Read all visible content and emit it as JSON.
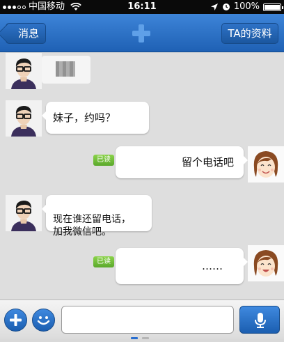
{
  "status_bar": {
    "carrier": "中国移动",
    "time": "16:11",
    "battery": "100%"
  },
  "nav": {
    "back_label": "消息",
    "profile_label": "TA的资料"
  },
  "messages": [
    {
      "side": "left",
      "kind": "image"
    },
    {
      "side": "left",
      "kind": "text",
      "text": "妹子，约吗？"
    },
    {
      "side": "right",
      "kind": "text",
      "text": "留个电话吧",
      "status": "已读"
    },
    {
      "side": "left",
      "kind": "text",
      "text": "现在谁还留电话，\n加我微信吧。"
    },
    {
      "side": "right",
      "kind": "text",
      "text": "……",
      "status": "已读"
    }
  ],
  "input": {
    "value": "",
    "placeholder": ""
  },
  "page_indicator": {
    "total": 2,
    "current": 1
  },
  "colors": {
    "nav_blue": "#2a6fd0",
    "read_badge": "#6bbf34",
    "chat_bg": "#dedede"
  },
  "icons": {
    "add": "plus-icon",
    "emoji": "smiley-icon",
    "voice": "microphone-icon",
    "logo": "plus-logo-icon"
  }
}
